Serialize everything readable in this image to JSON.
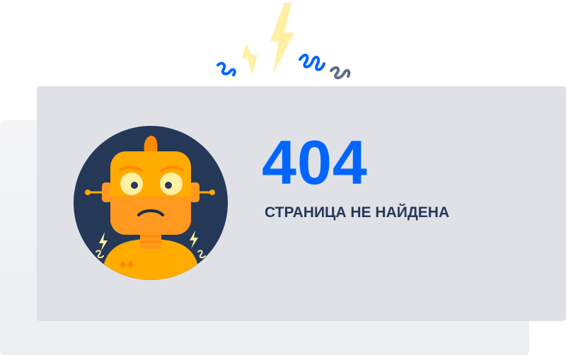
{
  "error": {
    "code": "404",
    "message": "СТРАНИЦА НЕ НАЙДЕНА"
  },
  "icons": {
    "illustration": "robot-avatar-icon",
    "decoration": "lightning-squiggles-icon"
  },
  "colors": {
    "accent": "#0065ff",
    "heading": "#253858",
    "card": "#dfe1e6",
    "avatar_bg": "#253858",
    "robot": "#ffab00",
    "bolt": "#fff0a3"
  }
}
